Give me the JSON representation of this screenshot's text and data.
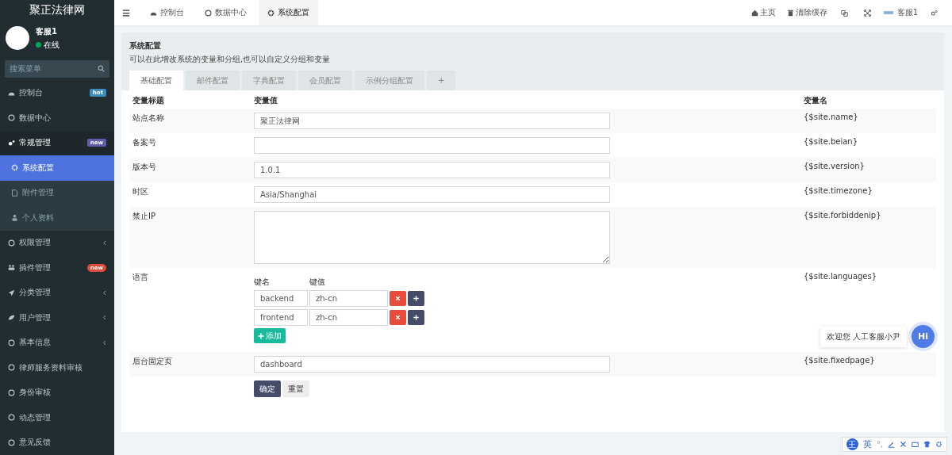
{
  "sidebar": {
    "logo": "聚正法律网",
    "user": {
      "name": "客服1",
      "status": "在线",
      "online": true
    },
    "search": {
      "placeholder": "搜索菜单"
    },
    "items": [
      {
        "label": "控制台",
        "badge": "hot",
        "color": "#3c8dbc",
        "expanded": false,
        "has_caret": false
      },
      {
        "label": "数据中心",
        "expanded": false,
        "has_caret": false
      },
      {
        "label": "常规管理",
        "badge": "new",
        "color": "#605ca8",
        "expanded": true,
        "has_caret": false,
        "children": [
          {
            "label": "系统配置",
            "selected": true
          },
          {
            "label": "附件管理",
            "selected": false
          },
          {
            "label": "个人资料",
            "selected": false
          }
        ]
      },
      {
        "label": "权限管理",
        "expanded": false,
        "has_caret": true
      },
      {
        "label": "插件管理",
        "badge": "new",
        "color": "#dd4b39",
        "expanded": false,
        "has_caret": false
      },
      {
        "label": "分类管理",
        "expanded": false,
        "has_caret": true
      },
      {
        "label": "用户管理",
        "expanded": false,
        "has_caret": true
      },
      {
        "label": "基本信息",
        "expanded": false,
        "has_caret": true
      },
      {
        "label": "律师服务资料审核",
        "expanded": false,
        "has_caret": false
      },
      {
        "label": "身份审核",
        "expanded": false,
        "has_caret": false
      },
      {
        "label": "动态管理",
        "expanded": false,
        "has_caret": false
      },
      {
        "label": "意见反馈",
        "expanded": false,
        "has_caret": false
      }
    ]
  },
  "topbar": {
    "tabs": [
      {
        "label": "控制台",
        "selected": false
      },
      {
        "label": "数据中心",
        "selected": false
      },
      {
        "label": "系统配置",
        "selected": true
      }
    ],
    "right": [
      {
        "kind": "link",
        "label": "主页"
      },
      {
        "kind": "link",
        "label": "清除缓存"
      },
      {
        "kind": "icon"
      },
      {
        "kind": "icon"
      },
      {
        "kind": "user",
        "label": "客服1"
      }
    ]
  },
  "panel": {
    "title": "系统配置",
    "description": "可以在此增改系统的变量和分组,也可以自定义分组和变量",
    "tabs": [
      {
        "label": "基础配置",
        "selected": true
      },
      {
        "label": "邮件配置",
        "selected": false
      },
      {
        "label": "字典配置",
        "selected": false
      },
      {
        "label": "会员配置",
        "selected": false
      },
      {
        "label": "示例分组配置",
        "selected": false
      },
      {
        "label": "+",
        "selected": false
      }
    ],
    "columns": [
      "变量标题",
      "变量值",
      "变量名"
    ],
    "rows": [
      {
        "kind": "text",
        "title": "站点名称",
        "value": "聚正法律网",
        "var": "{$site.name}"
      },
      {
        "kind": "text",
        "title": "备案号",
        "value": "",
        "var": "{$site.beian}"
      },
      {
        "kind": "text",
        "title": "版本号",
        "value": "1.0.1",
        "var": "{$site.version}"
      },
      {
        "kind": "text",
        "title": "时区",
        "value": "Asia/Shanghai",
        "var": "{$site.timezone}"
      },
      {
        "kind": "textarea",
        "title": "禁止IP",
        "value": "",
        "var": "{$site.forbiddenip}"
      },
      {
        "kind": "array",
        "title": "语言",
        "key_label": "键名",
        "value_label": "键值",
        "pairs": [
          {
            "key": "backend",
            "value": "zh-cn"
          },
          {
            "key": "frontend",
            "value": "zh-cn"
          }
        ],
        "add": "添加",
        "var": "{$site.languages}"
      },
      {
        "kind": "text",
        "title": "后台固定页",
        "value": "dashboard",
        "var": "{$site.fixedpage}"
      }
    ],
    "buttons": [
      {
        "label": "确定",
        "kind": "primary"
      },
      {
        "label": "重置",
        "kind": "default"
      }
    ]
  },
  "chat": {
    "message": "欢迎您 人工客服小尹",
    "button": "Hi"
  },
  "ime": {
    "logo": "王",
    "mode": "英",
    "dot": "°,"
  }
}
